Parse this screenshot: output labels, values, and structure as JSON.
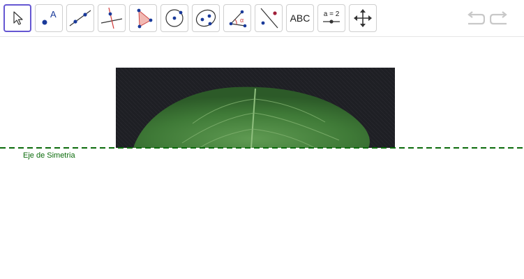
{
  "toolbar": {
    "tools": [
      {
        "name": "move-tool",
        "icon": "cursor-arrow-icon",
        "selected": true
      },
      {
        "name": "point-tool",
        "icon": "point-a-icon",
        "label": "A"
      },
      {
        "name": "line-tool",
        "icon": "line-through-points-icon"
      },
      {
        "name": "perpendicular-line-tool",
        "icon": "perpendicular-line-icon"
      },
      {
        "name": "polygon-tool",
        "icon": "polygon-icon"
      },
      {
        "name": "circle-tool",
        "icon": "circle-center-point-icon"
      },
      {
        "name": "conic-tool",
        "icon": "ellipse-icon"
      },
      {
        "name": "angle-tool",
        "icon": "angle-icon",
        "label": "α"
      },
      {
        "name": "reflect-tool",
        "icon": "reflect-about-line-icon"
      },
      {
        "name": "text-tool",
        "icon": "text-icon",
        "label": "ABC"
      },
      {
        "name": "slider-tool",
        "icon": "slider-icon",
        "label": "a = 2"
      },
      {
        "name": "move-graphics-view-tool",
        "icon": "move-arrows-icon"
      }
    ],
    "undo_icon": "undo-icon",
    "redo_icon": "redo-icon"
  },
  "canvas": {
    "image": {
      "description_icon": "leaf-image"
    },
    "symmetry_axis": {
      "label": "Eje de Simetria",
      "color": "#0b6b0b",
      "style": "dashed"
    }
  },
  "colors": {
    "selected_border": "#6557d2",
    "point_blue": "#1a3a9a",
    "polygon_fill": "#f2b9b3",
    "axis_green": "#0b6b0b"
  }
}
